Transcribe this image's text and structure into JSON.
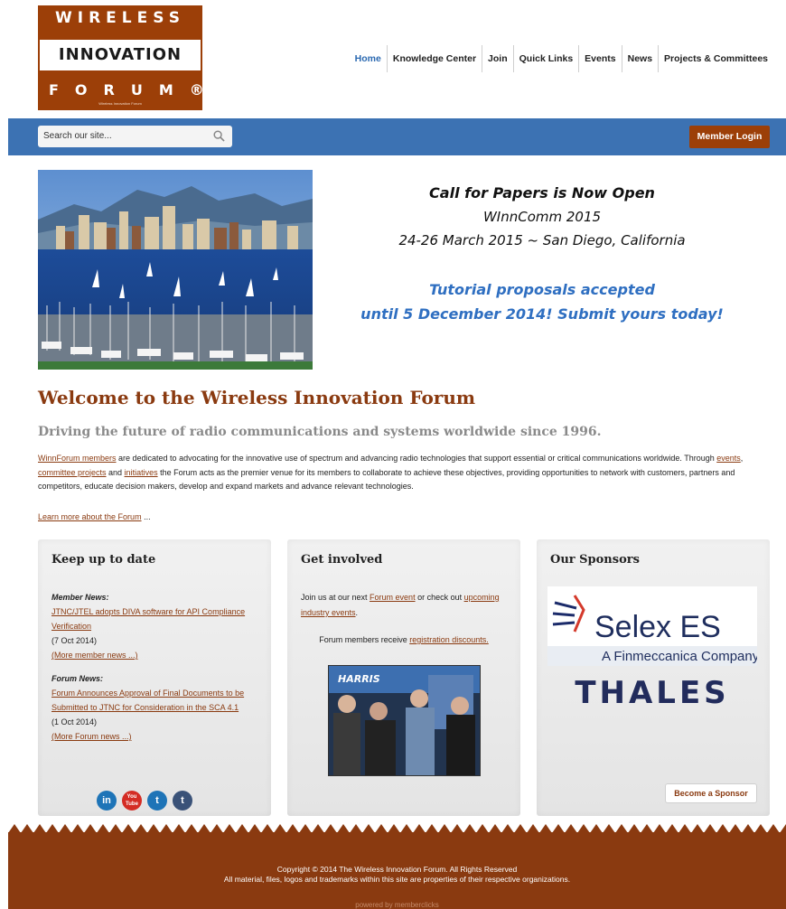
{
  "logo": {
    "line1": "WIRELESS",
    "line2": "INNOVATION",
    "line3": "FORUM®",
    "fine_print": "Wireless Innovation Forum"
  },
  "nav": {
    "items": [
      "Home",
      "Knowledge Center",
      "Join",
      "Quick Links",
      "Events",
      "News",
      "Projects & Committees"
    ]
  },
  "search": {
    "placeholder": "Search our site..."
  },
  "member_login": "Member Login",
  "banner": {
    "line1": "Call for Papers is Now Open",
    "line2": "WInnComm 2015",
    "line3": "24-26 March 2015 ~ San Diego, California",
    "line4": "Tutorial proposals accepted",
    "line5": "until 5 December 2014! Submit yours today!"
  },
  "welcome": {
    "title": "Welcome to the Wireless Innovation Forum",
    "tagline": "Driving the future of radio communications and systems worldwide since 1996.",
    "p_link1": "WinnForum members",
    "p_text1": " are dedicated to advocating for the innovative use of spectrum and advancing radio technologies that support essential or critical communications worldwide. Through ",
    "p_link2": "events",
    "p_text2": ", ",
    "p_link3": "committee projects",
    "p_text3": " and ",
    "p_link4": "initiatives",
    "p_text4": " the Forum acts as the premier venue for its members to collaborate to achieve these objectives, providing opportunities to network with customers, partners and competitors, educate decision makers, develop and expand markets and advance relevant technologies.",
    "learn_more": "Learn more about the Forum",
    "learn_more_suffix": " ..."
  },
  "keep_up": {
    "title": "Keep up to date",
    "member_news_label": "Member News:",
    "member_news_link": "JTNC/JTEL adopts DIVA software for API Compliance Verification",
    "member_news_date": "(7 Oct 2014)",
    "member_news_more": "(More member news ...)",
    "forum_news_label": "Forum News:",
    "forum_news_link": "Forum Announces Approval of Final Documents to be Submitted to JTNC for Consideration in the SCA 4.1",
    "forum_news_date": "(1 Oct 2014)",
    "forum_news_more": "(More Forum news ...)",
    "social": [
      "in",
      "You Tube",
      "t",
      "t"
    ]
  },
  "get_involved": {
    "title": "Get involved",
    "text1": "Join us at our next ",
    "link1": "Forum event",
    "text2": " or check out ",
    "link2": "upcoming industry events",
    "text3": ".",
    "text4": "Forum members receive ",
    "link3": "registration discounts.",
    "photo_sign": "HARRIS"
  },
  "sponsors": {
    "title": "Our Sponsors",
    "sponsor1_name": "Selex ES",
    "sponsor1_sub": "A Finmeccanica Company",
    "sponsor2_name": "THALES",
    "become_button": "Become a Sponsor"
  },
  "footer": {
    "copyright": "Copyright © 2014 The Wireless Innovation Forum. All Rights Reserved",
    "rights": "All material, files, logos and trademarks within this site are properties of their respective organizations.",
    "powered": "powered by memberclicks"
  },
  "colors": {
    "brand_brown": "#8a3a10",
    "header_blue": "#3c72b3",
    "tutorial_blue": "#2f6fc1"
  }
}
